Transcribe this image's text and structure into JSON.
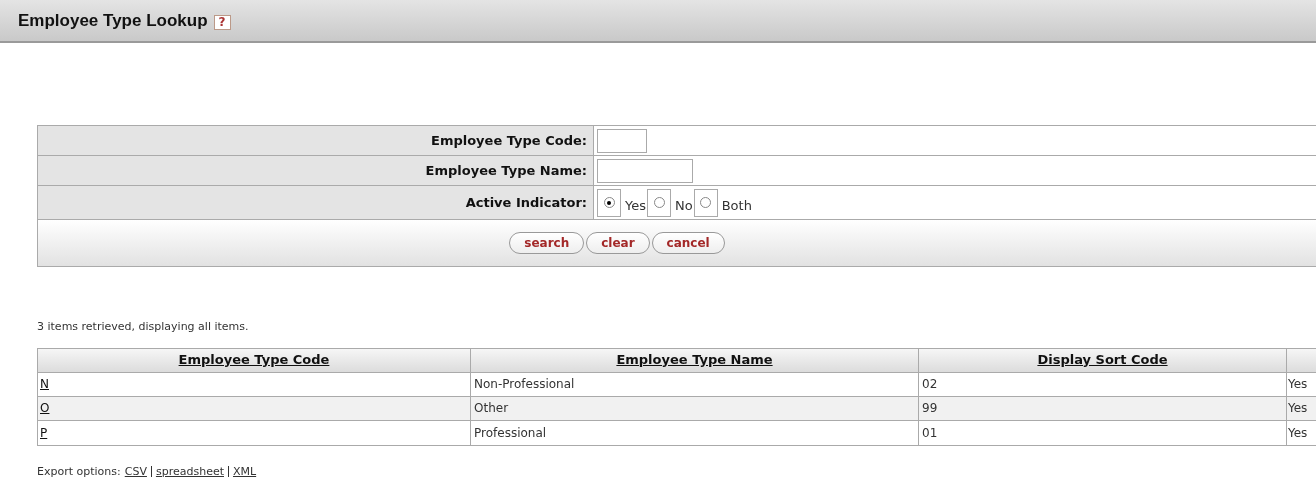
{
  "header": {
    "title": "Employee Type Lookup",
    "help_icon": "?"
  },
  "criteria": [
    {
      "label": "Employee Type Code:",
      "kind": "text"
    },
    {
      "label": "Employee Type Name:",
      "kind": "text"
    },
    {
      "label": "Active Indicator:",
      "kind": "radio",
      "options": [
        {
          "label": "Yes",
          "selected": true
        },
        {
          "label": "No",
          "selected": false
        },
        {
          "label": "Both",
          "selected": false
        }
      ]
    }
  ],
  "buttons": [
    "search",
    "clear",
    "cancel"
  ],
  "results_summary": "3 items retrieved, displaying all items.",
  "table": {
    "columns": [
      "Employee Type Code",
      "Employee Type Name",
      "Display Sort Code"
    ],
    "rows": [
      {
        "code": "N",
        "name": "Non-Professional",
        "sort_code": "02",
        "column_4": "Yes"
      },
      {
        "code": "O",
        "name": "Other",
        "sort_code": "99",
        "column_4": "Yes"
      },
      {
        "code": "P",
        "name": "Professional",
        "sort_code": "01",
        "column_4": "Yes"
      }
    ]
  },
  "export": {
    "label": "Export options:",
    "options": [
      "CSV",
      "spreadsheet",
      "XML"
    ]
  }
}
